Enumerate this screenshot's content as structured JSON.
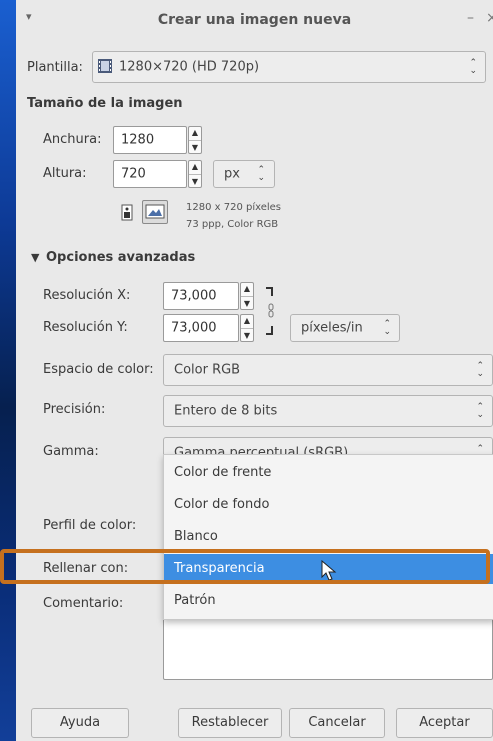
{
  "window": {
    "title": "Crear una imagen nueva",
    "menu_glyph": "▾",
    "minimize_glyph": "–",
    "close_glyph": "×"
  },
  "template": {
    "label": "Plantilla:",
    "value": "1280×720 (HD 720p)",
    "icon": "film-icon"
  },
  "image_size": {
    "heading": "Tamaño de la imagen",
    "width_label": "Anchura:",
    "width_value": "1280",
    "height_label": "Altura:",
    "height_value": "720",
    "unit": "px",
    "info_line1": "1280 x 720 píxeles",
    "info_line2": "73 ppp, Color RGB"
  },
  "advanced": {
    "heading": "Opciones avanzadas",
    "expander_glyph": "▼",
    "res_x_label": "Resolución X:",
    "res_x_value": "73,000",
    "res_y_label": "Resolución Y:",
    "res_y_value": "73,000",
    "res_unit": "píxeles/in",
    "colorspace_label": "Espacio de color:",
    "colorspace_value": "Color RGB",
    "precision_label": "Precisión:",
    "precision_value": "Entero de 8 bits",
    "gamma_label": "Gamma:",
    "gamma_value": "Gamma perceptual (sRGB)",
    "profile_label": "Perfil de color:",
    "fill_label": "Rellenar con:",
    "comment_label": "Comentario:"
  },
  "fill_menu": {
    "items": [
      "Color de frente",
      "Color de fondo",
      "Blanco",
      "Transparencia",
      "Patrón"
    ],
    "selected_index": 3
  },
  "buttons": {
    "help": "Ayuda",
    "reset": "Restablecer",
    "cancel": "Cancelar",
    "accept": "Aceptar"
  },
  "colors": {
    "accent": "#3d8ee2",
    "highlight_border": "#c5701e",
    "dialog_bg": "#e9e9e9"
  }
}
